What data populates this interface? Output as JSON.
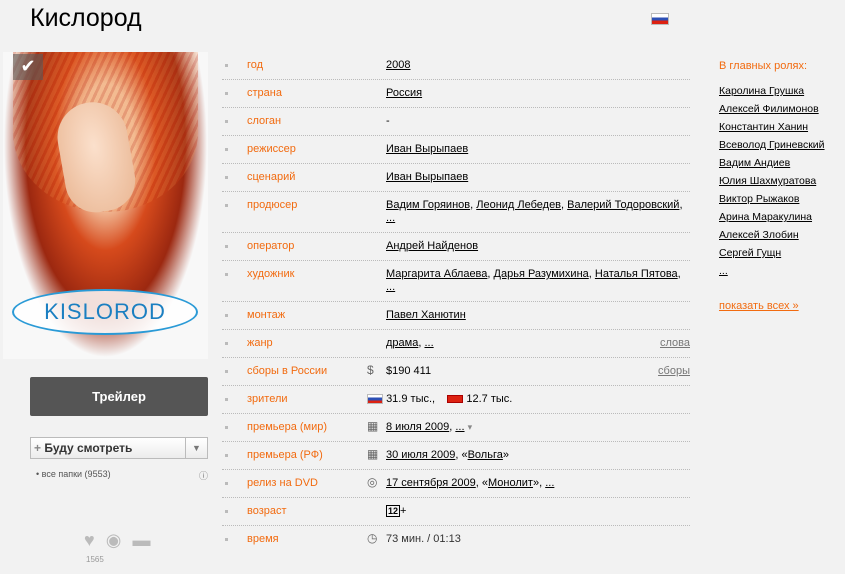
{
  "title": "Кислород",
  "poster": {
    "logo_text": "KISLOROD",
    "check_glyph": "✔"
  },
  "trailer_label": "Трейлер",
  "watch": {
    "label": "Буду смотреть",
    "plus": "+",
    "arrow": "▼"
  },
  "folders_text": "все папки (9553)",
  "info_glyph": "ⓘ",
  "likes_count": "1565",
  "icons": {
    "heart": "♥",
    "eye": "◉",
    "comment": "▬"
  },
  "rows": [
    {
      "label": "год",
      "value": "2008"
    },
    {
      "label": "страна",
      "value": "Россия"
    },
    {
      "label": "слоган",
      "value": "-"
    },
    {
      "label": "режиссер",
      "value": "Иван Вырыпаев"
    },
    {
      "label": "сценарий",
      "value": "Иван Вырыпаев"
    },
    {
      "label": "продюсер",
      "value": [
        "Вадим Горяинов",
        "Леонид Лебедев",
        "Валерий Тодоровский",
        "..."
      ]
    },
    {
      "label": "оператор",
      "value": "Андрей Найденов"
    },
    {
      "label": "художник",
      "value": [
        "Маргарита Аблаева",
        "Дарья Разумихина",
        "Наталья Пятова",
        "..."
      ]
    },
    {
      "label": "монтаж",
      "value": "Павел Ханютин"
    },
    {
      "label": "жанр",
      "value": [
        "драма",
        "..."
      ],
      "right": "слова"
    },
    {
      "label": "сборы в России",
      "value": "$190 411",
      "right": "сборы"
    },
    {
      "label": "зрители",
      "ru": "31.9 тыс.,",
      "other": "12.7 тыс."
    },
    {
      "label": "премьера (мир)",
      "value": "8 июля 2009",
      "extra": "..."
    },
    {
      "label": "премьера (РФ)",
      "value": "30 июля 2009",
      "extra": "Вольга"
    },
    {
      "label": "релиз на DVD",
      "value": "17 сентября 2009",
      "extra": "Монолит",
      "more": "..."
    },
    {
      "label": "возраст",
      "value": "12",
      "plus": "+"
    },
    {
      "label": "время",
      "value": "73 мин. / 01:13"
    }
  ],
  "cast": {
    "title": "В главных ролях:",
    "actors": [
      "Каролина Грушка",
      "Алексей Филимонов",
      "Константин Ханин",
      "Всеволод Гриневский",
      "Вадим Андиев",
      "Юлия Шахмуратова",
      "Виктор Рыжаков",
      "Арина Маракулина",
      "Алексей Злобин",
      "Сергей Гущн",
      "..."
    ],
    "show_all": "показать всех »"
  }
}
